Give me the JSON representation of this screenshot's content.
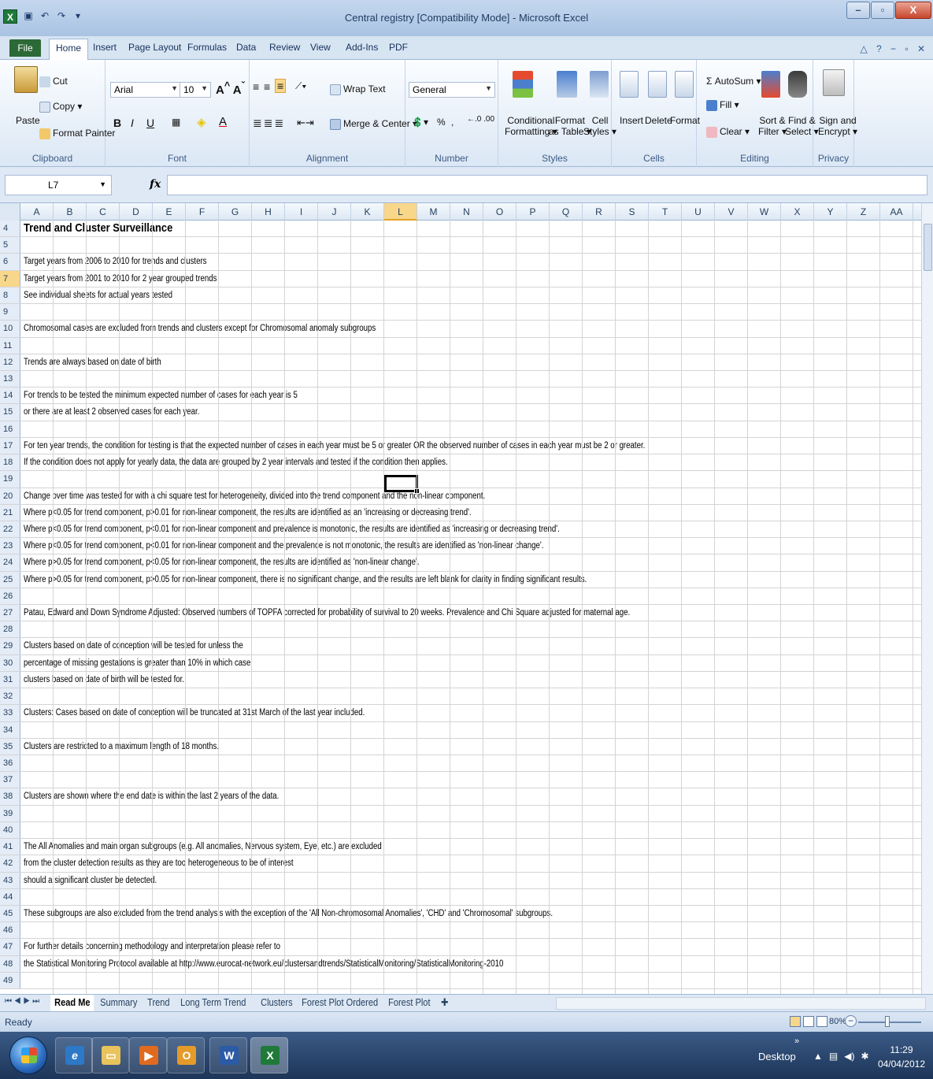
{
  "window": {
    "title": "Central registry  [Compatibility Mode] - Microsoft Excel"
  },
  "ribbon_tabs": [
    "File",
    "Home",
    "Insert",
    "Page Layout",
    "Formulas",
    "Data",
    "Review",
    "View",
    "Add-Ins",
    "PDF"
  ],
  "ribbon": {
    "clipboard": {
      "paste": "Paste",
      "cut": "Cut",
      "copy": "Copy ▾",
      "format_painter": "Format Painter",
      "label": "Clipboard"
    },
    "font": {
      "name": "Arial",
      "size": "10",
      "label": "Font"
    },
    "alignment": {
      "wrap_text": "Wrap Text",
      "merge_center": "Merge & Center ▾",
      "label": "Alignment"
    },
    "number": {
      "format": "General",
      "label": "Number"
    },
    "styles": {
      "conditional": "Conditional",
      "conditional2": "Formatting ▾",
      "format_as": "Format",
      "format_as2": "as Table ▾",
      "cell": "Cell",
      "cell2": "Styles ▾",
      "label": "Styles"
    },
    "cells": {
      "insert": "Insert",
      "delete": "Delete",
      "format": "Format",
      "label": "Cells"
    },
    "editing": {
      "autosum": "AutoSum ▾",
      "fill": "Fill ▾",
      "clear": "Clear ▾",
      "sort": "Sort &",
      "sort2": "Filter ▾",
      "find": "Find &",
      "find2": "Select ▾",
      "label": "Editing"
    },
    "privacy": {
      "sign": "Sign and",
      "sign2": "Encrypt ▾",
      "label": "Privacy"
    }
  },
  "formula_bar": {
    "name_box": "L7",
    "formula": ""
  },
  "columns": [
    "A",
    "B",
    "C",
    "D",
    "E",
    "F",
    "G",
    "H",
    "I",
    "J",
    "K",
    "L",
    "M",
    "N",
    "O",
    "P",
    "Q",
    "R",
    "S",
    "T",
    "U",
    "V",
    "W",
    "X",
    "Y",
    "Z",
    "AA"
  ],
  "selected_column": "L",
  "selected_row": "7",
  "rows": [
    {
      "n": "4",
      "text": "Trend and Cluster Surveillance",
      "heading": true
    },
    {
      "n": "5",
      "text": ""
    },
    {
      "n": "6",
      "text": "Target years from 2006 to 2010 for trends and clusters"
    },
    {
      "n": "7",
      "text": "Target years from 2001 to 2010 for 2 year grouped trends"
    },
    {
      "n": "8",
      "text": "See individual sheets for actual years tested"
    },
    {
      "n": "9",
      "text": ""
    },
    {
      "n": "10",
      "text": "Chromosomal cases are excluded from trends and clusters except for Chromosomal anomaly subgroups"
    },
    {
      "n": "11",
      "text": ""
    },
    {
      "n": "12",
      "text": "Trends are always based on date of birth"
    },
    {
      "n": "13",
      "text": ""
    },
    {
      "n": "14",
      "text": "For trends to be tested the minimum expected number of cases for each year is 5"
    },
    {
      "n": "15",
      "text": "or there are at least 2 observed cases for each year."
    },
    {
      "n": "16",
      "text": ""
    },
    {
      "n": "17",
      "text": "For ten year trends, the condition for testing is that the expected number of cases in each year must be 5 or greater OR the observed number of cases in each year must be 2 or greater."
    },
    {
      "n": "18",
      "text": "If the condition does not apply for yearly data, the data are grouped by 2 year intervals and tested if the condition then applies."
    },
    {
      "n": "19",
      "text": ""
    },
    {
      "n": "20",
      "text": "Change over time was tested for with a chi square test for heterogeneity, divided into the trend component and the non-linear component."
    },
    {
      "n": "21",
      "text": "Where p<0.05 for trend component, p>0.01 for non-linear component, the results are identified as an 'increasing or decreasing trend'."
    },
    {
      "n": "22",
      "text": "Where p<0.05 for trend component, p<0.01 for non-linear component and prevalence is monotonic, the results are identified as 'increasing or decreasing trend'."
    },
    {
      "n": "23",
      "text": "Where p<0.05 for trend component, p<0.01 for non-linear component and the prevalence is not monotonic, the results are identified as 'non-linear change'."
    },
    {
      "n": "24",
      "text": "Where p>0.05 for trend component, p<0.05 for non-linear component, the results are identified as 'non-linear change'."
    },
    {
      "n": "25",
      "text": "Where p>0.05 for trend component, p>0.05 for non-linear component, there is no significant change, and the results are left blank for clarity in finding significant results."
    },
    {
      "n": "26",
      "text": ""
    },
    {
      "n": "27",
      "text": "Patau, Edward and Down Syndrome Adjusted: Observed numbers of TOPFA corrected for probability of survival to 20 weeks.  Prevalence and Chi Square adjusted for maternal age."
    },
    {
      "n": "28",
      "text": ""
    },
    {
      "n": "29",
      "text": "Clusters based on date of conception will be tested for unless the"
    },
    {
      "n": "30",
      "text": "percentage of missing gestations is greater than 10% in which case"
    },
    {
      "n": "31",
      "text": "clusters based on date of birth will be tested for."
    },
    {
      "n": "32",
      "text": ""
    },
    {
      "n": "33",
      "text": "Clusters: Cases based on date of conception will be truncated at 31st March of the last year included."
    },
    {
      "n": "34",
      "text": ""
    },
    {
      "n": "35",
      "text": "Clusters are restricted to a maximum length of 18 months."
    },
    {
      "n": "36",
      "text": ""
    },
    {
      "n": "37",
      "text": ""
    },
    {
      "n": "38",
      "text": "Clusters are shown where the end date is within the last 2 years of the data."
    },
    {
      "n": "39",
      "text": ""
    },
    {
      "n": "40",
      "text": ""
    },
    {
      "n": "41",
      "text": "The All Anomalies and main organ subgroups (e.g. All anomalies, Nervous system, Eye, etc.) are excluded"
    },
    {
      "n": "42",
      "text": "from the cluster detection results as they are too heterogeneous to be of interest"
    },
    {
      "n": "43",
      "text": "should a significant cluster be detected."
    },
    {
      "n": "44",
      "text": ""
    },
    {
      "n": "45",
      "text": "These subgroups are also excluded from the trend analysis with the exception of the 'All Non-chromosomal Anomalies', 'CHD' and 'Chromosomal' subgroups."
    },
    {
      "n": "46",
      "text": ""
    },
    {
      "n": "47",
      "text": "For further details concerning methodology and interpretation please refer to"
    },
    {
      "n": "48",
      "text": "the Statistical Monitoring Protocol available at http://www.eurocat-network.eu/clustersandtrends/StatisticalMonitoring/StatisticalMonitoring-2010"
    },
    {
      "n": "49",
      "text": ""
    }
  ],
  "sheet_tabs": [
    "Read Me",
    "Summary",
    "Trend",
    "Long Term Trend",
    "Clusters",
    "Forest Plot Ordered",
    "Forest Plot"
  ],
  "active_sheet": "Read Me",
  "status": {
    "ready": "Ready",
    "zoom": "80%"
  },
  "taskbar": {
    "desktop": "Desktop",
    "time": "11:29",
    "date": "04/04/2012"
  },
  "colors": {
    "excel_green": "#1f7a3a",
    "selection": "#f8d78a",
    "ribbon_blue": "#dbe7f5"
  }
}
